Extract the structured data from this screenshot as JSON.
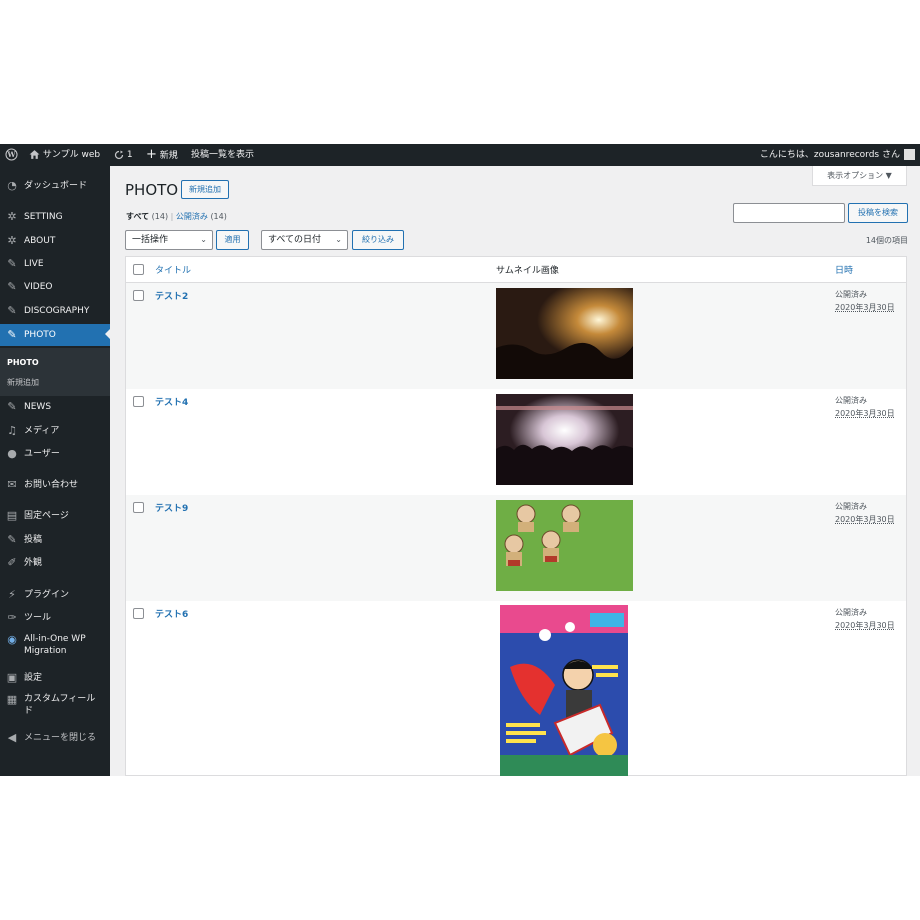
{
  "admin_bar": {
    "site_name": "サンプル web",
    "updates_count": "1",
    "new_label": "新規",
    "view_posts_label": "投稿一覧を表示",
    "greeting": "こんにちは、zousanrecords さん"
  },
  "sidebar": {
    "items": [
      {
        "label": "ダッシュボード",
        "icon": "dashboard-icon"
      },
      {
        "label": "SETTING",
        "icon": "gear-icon"
      },
      {
        "label": "ABOUT",
        "icon": "gear-icon"
      },
      {
        "label": "LIVE",
        "icon": "pin-icon"
      },
      {
        "label": "VIDEO",
        "icon": "pin-icon"
      },
      {
        "label": "DISCOGRAPHY",
        "icon": "pin-icon"
      },
      {
        "label": "PHOTO",
        "icon": "pin-icon"
      },
      {
        "label": "NEWS",
        "icon": "pin-icon"
      },
      {
        "label": "メディア",
        "icon": "media-icon"
      },
      {
        "label": "ユーザー",
        "icon": "user-icon"
      },
      {
        "label": "お問い合わせ",
        "icon": "mail-icon"
      },
      {
        "label": "固定ページ",
        "icon": "page-icon"
      },
      {
        "label": "投稿",
        "icon": "pin-icon"
      },
      {
        "label": "外観",
        "icon": "brush-icon"
      },
      {
        "label": "プラグイン",
        "icon": "plugin-icon"
      },
      {
        "label": "ツール",
        "icon": "wrench-icon"
      },
      {
        "label": "All-in-One WP",
        "label2": "Migration",
        "icon": "migration-icon"
      },
      {
        "label": "設定",
        "icon": "settings-icon"
      },
      {
        "label": "カスタムフィール",
        "label2": "ド",
        "icon": "grid-icon"
      },
      {
        "label": "メニューを閉じる",
        "icon": "collapse-icon"
      }
    ],
    "submenu": {
      "current": "PHOTO",
      "add_new": "新規追加"
    }
  },
  "page": {
    "title": "PHOTO",
    "add_new_button": "新規追加",
    "screen_options": "表示オプション ▼",
    "filters": {
      "all_label": "すべて",
      "all_count": "(14)",
      "separator": "|",
      "published_label": "公開済み",
      "published_count": "(14)"
    },
    "search": {
      "placeholder": "",
      "button": "投稿を検索"
    },
    "bulk_action": {
      "selected": "一括操作",
      "apply": "適用"
    },
    "date_filter": {
      "selected": "すべての日付",
      "filter_button": "絞り込み"
    },
    "item_count": "14個の項目"
  },
  "table": {
    "headers": {
      "title": "タイトル",
      "thumbnail": "サムネイル画像",
      "date": "日時"
    },
    "rows": [
      {
        "title": "テスト2",
        "status": "公開済み",
        "date": "2020年3月30日",
        "image": "concert-stage-photo"
      },
      {
        "title": "テスト4",
        "status": "公開済み",
        "date": "2020年3月30日",
        "image": "live-crowd-photo"
      },
      {
        "title": "テスト9",
        "status": "公開済み",
        "date": "2020年3月30日",
        "image": "figures-on-green-photo"
      },
      {
        "title": "テスト6",
        "status": "公開済み",
        "date": "2020年3月30日",
        "image": "event-poster-illustration"
      }
    ]
  },
  "colors": {
    "admin_dark": "#1d2327",
    "accent": "#2271b1",
    "background": "#f0f0f1"
  }
}
